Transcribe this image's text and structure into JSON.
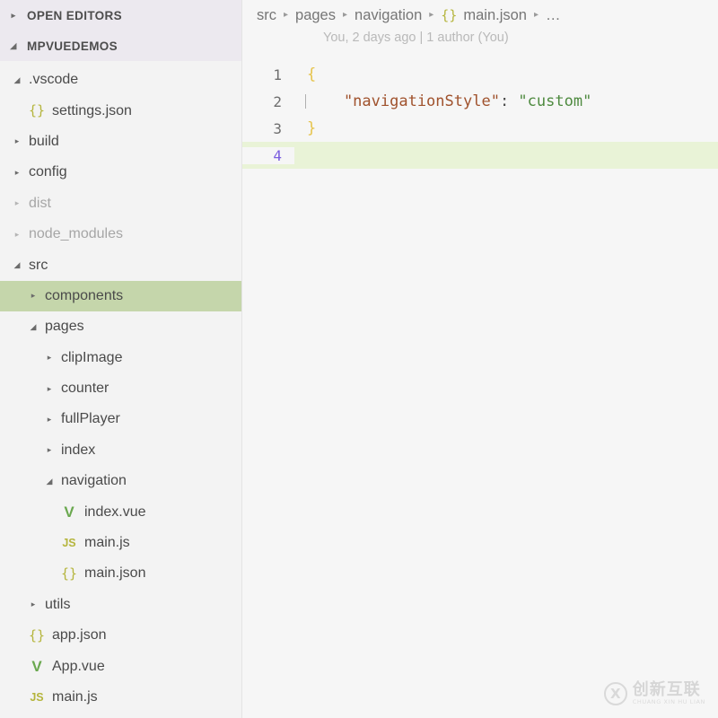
{
  "sidebar": {
    "open_editors": {
      "label": "OPEN EDITORS",
      "twisty": "collapsed",
      "twisty_glyph": "▸"
    },
    "project_root": {
      "label": "MPVUEDEMOS",
      "twisty": "expanded",
      "twisty_glyph": "◢"
    },
    "tree": [
      {
        "label": ".vscode",
        "type": "folder",
        "state": "expanded",
        "depth": 1,
        "dim": false,
        "selected": false,
        "icon": "chevron-down-icon"
      },
      {
        "label": "settings.json",
        "type": "file",
        "state": "none",
        "depth": 2,
        "dim": false,
        "selected": false,
        "icon": "json-file-icon",
        "icon_glyph": "{}"
      },
      {
        "label": "build",
        "type": "folder",
        "state": "collapsed",
        "depth": 1,
        "dim": false,
        "selected": false,
        "icon": "chevron-right-icon"
      },
      {
        "label": "config",
        "type": "folder",
        "state": "collapsed",
        "depth": 1,
        "dim": false,
        "selected": false,
        "icon": "chevron-right-icon"
      },
      {
        "label": "dist",
        "type": "folder",
        "state": "collapsed",
        "depth": 1,
        "dim": true,
        "selected": false,
        "icon": "chevron-right-icon"
      },
      {
        "label": "node_modules",
        "type": "folder",
        "state": "collapsed",
        "depth": 1,
        "dim": true,
        "selected": false,
        "icon": "chevron-right-icon"
      },
      {
        "label": "src",
        "type": "folder",
        "state": "expanded",
        "depth": 1,
        "dim": false,
        "selected": false,
        "icon": "chevron-down-icon"
      },
      {
        "label": "components",
        "type": "folder",
        "state": "collapsed",
        "depth": 2,
        "dim": false,
        "selected": true,
        "icon": "chevron-right-icon"
      },
      {
        "label": "pages",
        "type": "folder",
        "state": "expanded",
        "depth": 2,
        "dim": false,
        "selected": false,
        "icon": "chevron-down-icon"
      },
      {
        "label": "clipImage",
        "type": "folder",
        "state": "collapsed",
        "depth": 3,
        "dim": false,
        "selected": false,
        "icon": "chevron-right-icon"
      },
      {
        "label": "counter",
        "type": "folder",
        "state": "collapsed",
        "depth": 3,
        "dim": false,
        "selected": false,
        "icon": "chevron-right-icon"
      },
      {
        "label": "fullPlayer",
        "type": "folder",
        "state": "collapsed",
        "depth": 3,
        "dim": false,
        "selected": false,
        "icon": "chevron-right-icon"
      },
      {
        "label": "index",
        "type": "folder",
        "state": "collapsed",
        "depth": 3,
        "dim": false,
        "selected": false,
        "icon": "chevron-right-icon"
      },
      {
        "label": "navigation",
        "type": "folder",
        "state": "expanded",
        "depth": 3,
        "dim": false,
        "selected": false,
        "icon": "chevron-down-icon"
      },
      {
        "label": "index.vue",
        "type": "file",
        "state": "none",
        "depth": 4,
        "dim": false,
        "selected": false,
        "icon": "vue-file-icon",
        "icon_glyph": "V"
      },
      {
        "label": "main.js",
        "type": "file",
        "state": "none",
        "depth": 4,
        "dim": false,
        "selected": false,
        "icon": "js-file-icon",
        "icon_glyph": "JS"
      },
      {
        "label": "main.json",
        "type": "file",
        "state": "none",
        "depth": 4,
        "dim": false,
        "selected": false,
        "icon": "json-file-icon",
        "icon_glyph": "{}"
      },
      {
        "label": "utils",
        "type": "folder",
        "state": "collapsed",
        "depth": 2,
        "dim": false,
        "selected": false,
        "icon": "chevron-right-icon"
      },
      {
        "label": "app.json",
        "type": "file",
        "state": "none",
        "depth": 2,
        "dim": false,
        "selected": false,
        "icon": "json-file-icon",
        "icon_glyph": "{}"
      },
      {
        "label": "App.vue",
        "type": "file",
        "state": "none",
        "depth": 2,
        "dim": false,
        "selected": false,
        "icon": "vue-file-icon",
        "icon_glyph": "V"
      },
      {
        "label": "main.js",
        "type": "file",
        "state": "none",
        "depth": 2,
        "dim": false,
        "selected": false,
        "icon": "js-file-icon",
        "icon_glyph": "JS"
      }
    ]
  },
  "editor": {
    "breadcrumb": {
      "separator": "▸",
      "items": [
        {
          "label": "src",
          "icon": null
        },
        {
          "label": "pages",
          "icon": null
        },
        {
          "label": "navigation",
          "icon": null
        },
        {
          "label": "main.json",
          "icon": "json-file-icon",
          "icon_glyph": "{}"
        },
        {
          "label": "…",
          "icon": null
        }
      ]
    },
    "blame": "You, 2 days ago | 1 author (You)",
    "lines": [
      {
        "number": "1",
        "active": false,
        "indent_guide": false,
        "tokens": [
          {
            "text": "{",
            "kind": "brace"
          }
        ]
      },
      {
        "number": "2",
        "active": false,
        "indent_guide": true,
        "tokens": [
          {
            "text": "    \"navigationStyle\"",
            "kind": "key"
          },
          {
            "text": ": ",
            "kind": "colon"
          },
          {
            "text": "\"custom\"",
            "kind": "str"
          }
        ]
      },
      {
        "number": "3",
        "active": false,
        "indent_guide": false,
        "tokens": [
          {
            "text": "}",
            "kind": "brace"
          }
        ]
      },
      {
        "number": "4",
        "active": true,
        "indent_guide": false,
        "tokens": [
          {
            "text": "",
            "kind": "plain"
          }
        ]
      }
    ]
  },
  "watermark": {
    "mark": "X",
    "chinese": "创新互联",
    "pinyin": "CHUANG XIN HU LIAN"
  },
  "colors": {
    "sidebar_bg": "#f3f3f3",
    "editor_bg": "#f6f6f6",
    "section_header_bg": "#ece9ef",
    "selection_bg": "#c5d6ab",
    "active_line_bg": "#e9f3d7",
    "active_line_number": "#7b5ee0",
    "json_icon": "#b5b53d",
    "vue_icon": "#6aa84f",
    "token_brace": "#e6c34a",
    "token_key": "#a0522d",
    "token_string": "#4e8a3f"
  }
}
